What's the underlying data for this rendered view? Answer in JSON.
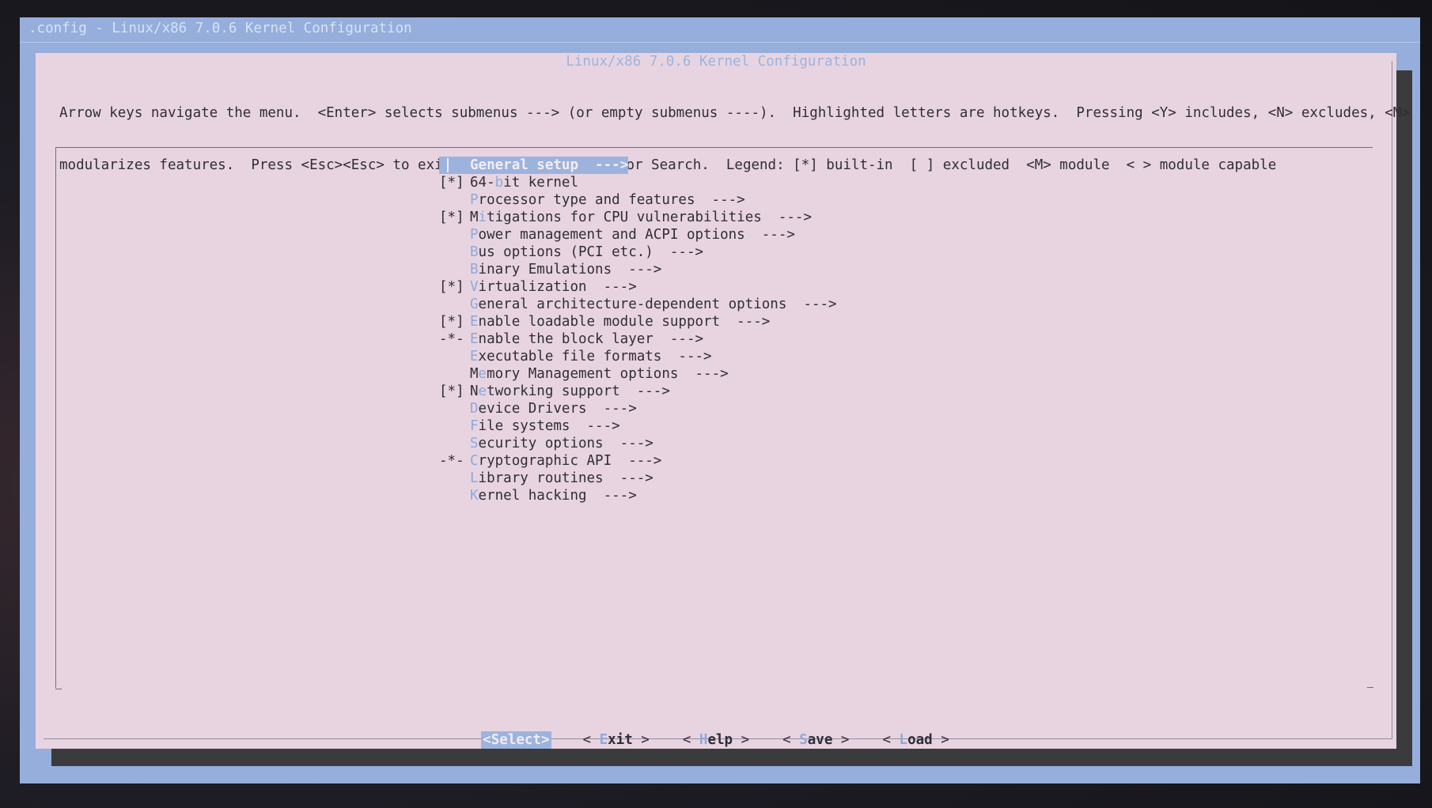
{
  "window": {
    "backtitle": ".config - Linux/x86 7.0.6 Kernel Configuration"
  },
  "dialog": {
    "title": "Linux/x86 7.0.6 Kernel Configuration",
    "instructions": [
      "Arrow keys navigate the menu.  <Enter> selects submenus ---> (or empty submenus ----).  Highlighted letters are hotkeys.  Pressing <Y> includes, <N> excludes, <M>",
      "modularizes features.  Press <Esc><Esc> to exit, <?> for Help, </> for Search.  Legend: [*] built-in  [ ] excluded  <M> module  < > module capable"
    ]
  },
  "menu": {
    "items": [
      {
        "mark": "",
        "pre": "",
        "hotkey": "G",
        "post": "eneral setup  --->",
        "selected": true
      },
      {
        "mark": "[*]",
        "pre": "64-",
        "hotkey": "b",
        "post": "it kernel",
        "selected": false
      },
      {
        "mark": "",
        "pre": "",
        "hotkey": "P",
        "post": "rocessor type and features  --->",
        "selected": false
      },
      {
        "mark": "[*]",
        "pre": "M",
        "hotkey": "i",
        "post": "tigations for CPU vulnerabilities  --->",
        "selected": false
      },
      {
        "mark": "",
        "pre": "",
        "hotkey": "P",
        "post": "ower management and ACPI options  --->",
        "selected": false
      },
      {
        "mark": "",
        "pre": "",
        "hotkey": "B",
        "post": "us options (PCI etc.)  --->",
        "selected": false
      },
      {
        "mark": "",
        "pre": "",
        "hotkey": "B",
        "post": "inary Emulations  --->",
        "selected": false
      },
      {
        "mark": "[*]",
        "pre": "",
        "hotkey": "V",
        "post": "irtualization  --->",
        "selected": false
      },
      {
        "mark": "",
        "pre": "",
        "hotkey": "G",
        "post": "eneral architecture-dependent options  --->",
        "selected": false
      },
      {
        "mark": "[*]",
        "pre": "",
        "hotkey": "E",
        "post": "nable loadable module support  --->",
        "selected": false
      },
      {
        "mark": "-*-",
        "pre": "",
        "hotkey": "E",
        "post": "nable the block layer  --->",
        "selected": false
      },
      {
        "mark": "",
        "pre": "",
        "hotkey": "E",
        "post": "xecutable file formats  --->",
        "selected": false
      },
      {
        "mark": "",
        "pre": "M",
        "hotkey": "e",
        "post": "mory Management options  --->",
        "selected": false
      },
      {
        "mark": "[*]",
        "pre": "N",
        "hotkey": "e",
        "post": "tworking support  --->",
        "selected": false
      },
      {
        "mark": "",
        "pre": "",
        "hotkey": "D",
        "post": "evice Drivers  --->",
        "selected": false
      },
      {
        "mark": "",
        "pre": "",
        "hotkey": "F",
        "post": "ile systems  --->",
        "selected": false
      },
      {
        "mark": "",
        "pre": "",
        "hotkey": "S",
        "post": "ecurity options  --->",
        "selected": false
      },
      {
        "mark": "-*-",
        "pre": "",
        "hotkey": "C",
        "post": "ryptographic API  --->",
        "selected": false
      },
      {
        "mark": "",
        "pre": "",
        "hotkey": "L",
        "post": "ibrary routines  --->",
        "selected": false
      },
      {
        "mark": "",
        "pre": "",
        "hotkey": "K",
        "post": "ernel hacking  --->",
        "selected": false
      }
    ]
  },
  "buttons": {
    "select": "<Select>",
    "exit": {
      "left": "< ",
      "hotkey": "E",
      "rest": "xit",
      "right": " >"
    },
    "help": {
      "left": "< ",
      "hotkey": "H",
      "rest": "elp",
      "right": " >"
    },
    "save": {
      "left": "< ",
      "hotkey": "S",
      "rest": "ave",
      "right": " >"
    },
    "load": {
      "left": "< ",
      "hotkey": "L",
      "rest": "oad",
      "right": " >"
    }
  },
  "colors": {
    "screen_bg": "#95aedc",
    "dialog_bg": "#e8d4e0",
    "highlight": "#9cb3de",
    "hotkey": "#8ea8dc",
    "text": "#2e2e36"
  }
}
